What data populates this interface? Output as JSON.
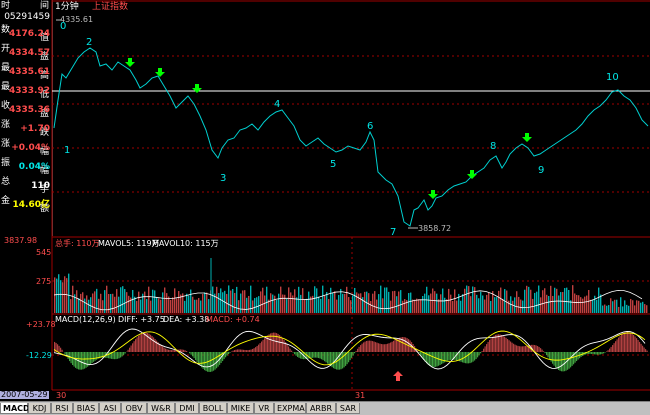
{
  "info_panel": {
    "time_label": "时",
    "time_value": "05291459",
    "time_right": "间",
    "rows": [
      {
        "label": "数",
        "right": "值",
        "value": "4176.24",
        "color": "#ff4d4d"
      },
      {
        "label": "开",
        "right": "盘",
        "value": "4334.57",
        "color": "#ff4d4d"
      },
      {
        "label": "最",
        "right": "高",
        "value": "4335.61",
        "color": "#ff4d4d"
      },
      {
        "label": "最",
        "right": "低",
        "value": "4333.92",
        "color": "#ff4d4d"
      },
      {
        "label": "收",
        "right": "盘",
        "value": "4335.36",
        "color": "#ff4d4d"
      },
      {
        "label": "涨",
        "right": "跌",
        "value": "+1.70",
        "color": "#ff4d4d"
      },
      {
        "label": "涨",
        "right": "幅",
        "value": "+0.04%",
        "color": "#ff4d4d"
      },
      {
        "label": "振",
        "right": "幅",
        "value": "0.04%",
        "color": "#00e6e6"
      },
      {
        "label": "总",
        "right": "手",
        "value": "110",
        "color": "#ffffff"
      },
      {
        "label": "金",
        "right": "额",
        "value": "14.60亿",
        "color": "#ffff00"
      }
    ]
  },
  "chart_header": {
    "period": "1分钟",
    "symbol": "上证指数",
    "high_marker": "4335.61"
  },
  "price_panel": {
    "low_marker": "3858.72",
    "axis_top": "3837.98",
    "wave_labels": [
      "0",
      "1",
      "2",
      "3",
      "4",
      "5",
      "6",
      "7",
      "8",
      "9",
      "10"
    ]
  },
  "volume_panel": {
    "header_total": "总手: 110万",
    "header_mavol5": "MAVOL5: 119万",
    "header_mavol10": "MAVOL10: 115万",
    "axis_top": "545",
    "axis_mid": "275"
  },
  "macd_panel": {
    "header_name": "MACD(12,26,9)",
    "header_diff": "DIFF: +3.75",
    "header_dea": "DEA: +3.38",
    "header_macd": "MACD: +0.74",
    "axis_top": "+23.78",
    "axis_mid": "-12.29"
  },
  "date_axis": {
    "date": "2007-05-29",
    "day1": "30",
    "day2": "31"
  },
  "tabs": [
    "MACD",
    "KDJ",
    "RSI",
    "BIAS",
    "ASI",
    "OBV",
    "W&R",
    "DMI",
    "BOLL",
    "MIKE",
    "VR",
    "EXPMA",
    "ARBR",
    "SAR"
  ],
  "active_tab": "MACD",
  "colors": {
    "up": "#ff4d4d",
    "down": "#00e6e6",
    "line": "#00e6e6",
    "arrow_down": "#00ff00",
    "arrow_up": "#ff4d4d"
  }
}
